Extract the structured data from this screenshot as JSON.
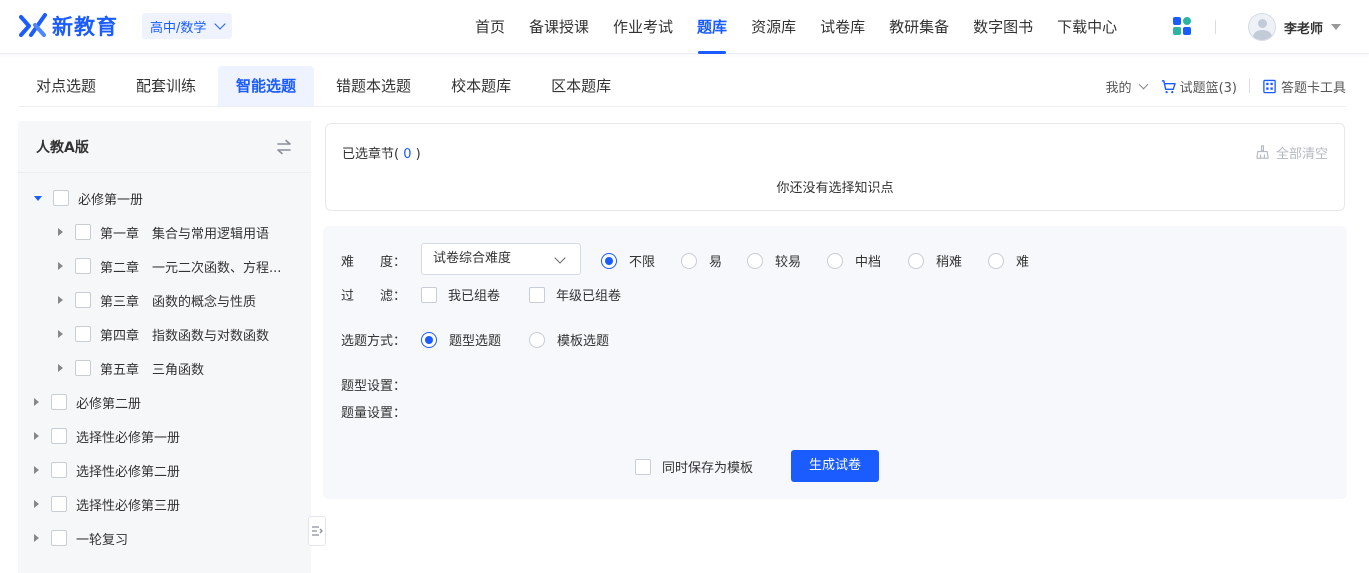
{
  "brand": {
    "name": "新教育",
    "accent": "#1a5cff"
  },
  "subject_select": {
    "value": "高中/数学"
  },
  "nav": {
    "items": [
      "首页",
      "备课授课",
      "作业考试",
      "题库",
      "资源库",
      "试卷库",
      "教研集备",
      "数字图书",
      "下载中心"
    ],
    "active": "题库"
  },
  "apps_icon": {
    "name": "apps-grid-icon",
    "colors": [
      "#1a5cff",
      "#2bb3a4",
      "#2bb3a4",
      "#1a5cff"
    ]
  },
  "user": {
    "name": "李老师"
  },
  "subtabs": {
    "items": [
      "对点选题",
      "配套训练",
      "智能选题",
      "错题本选题",
      "校本题库",
      "区本题库"
    ],
    "active": "智能选题"
  },
  "toolbar_right": {
    "mine": "我的",
    "basket": "试题篮(3)",
    "card_tool": "答题卡工具"
  },
  "left_panel": {
    "title": "人教A版",
    "tree": [
      {
        "label": "必修第一册",
        "expanded": true,
        "children": [
          "第一章　集合与常用逻辑用语",
          "第二章　一元二次函数、方程...",
          "第三章　函数的概念与性质",
          "第四章　指数函数与对数函数",
          "第五章　三角函数"
        ]
      },
      {
        "label": "必修第二册"
      },
      {
        "label": "选择性必修第一册"
      },
      {
        "label": "选择性必修第二册"
      },
      {
        "label": "选择性必修第三册"
      },
      {
        "label": "一轮复习"
      }
    ]
  },
  "selected": {
    "title_prefix": "已选章节(",
    "count": "0",
    "title_suffix": ")",
    "clear_all": "全部清空",
    "empty_msg": "你还没有选择知识点"
  },
  "options": {
    "difficulty_label": "难　　度：",
    "difficulty_select": "试卷综合难度",
    "difficulty_options": [
      "不限",
      "易",
      "较易",
      "中档",
      "稍难",
      "难"
    ],
    "difficulty_selected": "不限",
    "filter_label": "过　　滤：",
    "filter_options": [
      "我已组卷",
      "年级已组卷"
    ],
    "mode_label": "选题方式：",
    "mode_options": [
      "题型选题",
      "模板选题"
    ],
    "mode_selected": "题型选题",
    "type_setting_label": "题型设置：",
    "qty_setting_label": "题量设置：",
    "save_template": "同时保存为模板",
    "generate": "生成试卷"
  }
}
